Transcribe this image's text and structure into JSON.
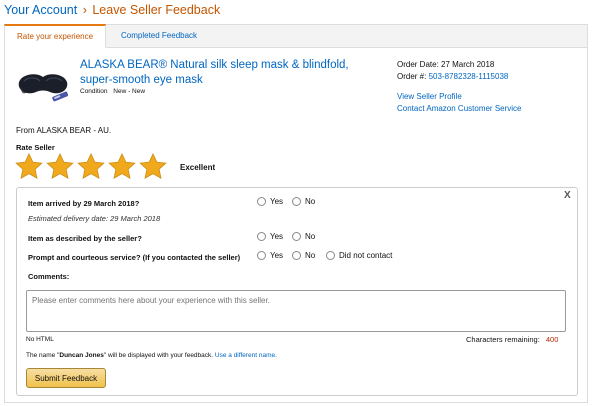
{
  "breadcrumb": {
    "parent": "Your Account",
    "separator": "›",
    "current": "Leave Seller Feedback"
  },
  "tabs": [
    {
      "label": "Rate your experience",
      "active": true
    },
    {
      "label": "Completed Feedback",
      "active": false
    }
  ],
  "product": {
    "title": "ALASKA BEAR® Natural silk sleep mask & blindfold, super-smooth eye mask",
    "condition_label": "Condition",
    "condition_value": "New - New",
    "image_icon": "sleep-mask-image"
  },
  "order": {
    "date": "Order Date: 27 March 2018",
    "number_label": "Order #:",
    "number_value": "503-8782328-1115038",
    "view_profile": "View Seller Profile",
    "contact_cs": "Contact Amazon Customer Service"
  },
  "seller": {
    "from": "From ALASKA BEAR - AU."
  },
  "rating": {
    "label": "Rate Seller",
    "stars_filled": 5,
    "stars_total": 5,
    "text": "Excellent",
    "star_color": "#f0a81c"
  },
  "feedback": {
    "close": "X",
    "q1": "Item arrived by 29 March 2018?",
    "q1_sub": "Estimated delivery date: 29 March 2018",
    "q2": "Item as described by the seller?",
    "q3": "Prompt and courteous service? (If you contacted the seller)",
    "yes": "Yes",
    "no": "No",
    "did_not_contact": "Did not contact",
    "comments_label": "Comments:",
    "comments_placeholder": "Please enter comments here about your experience with this seller.",
    "no_html": "No HTML",
    "chars_label": "Characters remaining:",
    "chars_value": "400",
    "name_prefix": "The name \"",
    "name_value": "Duncan Jones",
    "name_suffix": "\" will be displayed with your feedback.",
    "name_link": "Use a different name.",
    "submit": "Submit Feedback"
  },
  "colors": {
    "link": "#0066c0",
    "accent": "#c45500",
    "button": "#f0c14b"
  }
}
